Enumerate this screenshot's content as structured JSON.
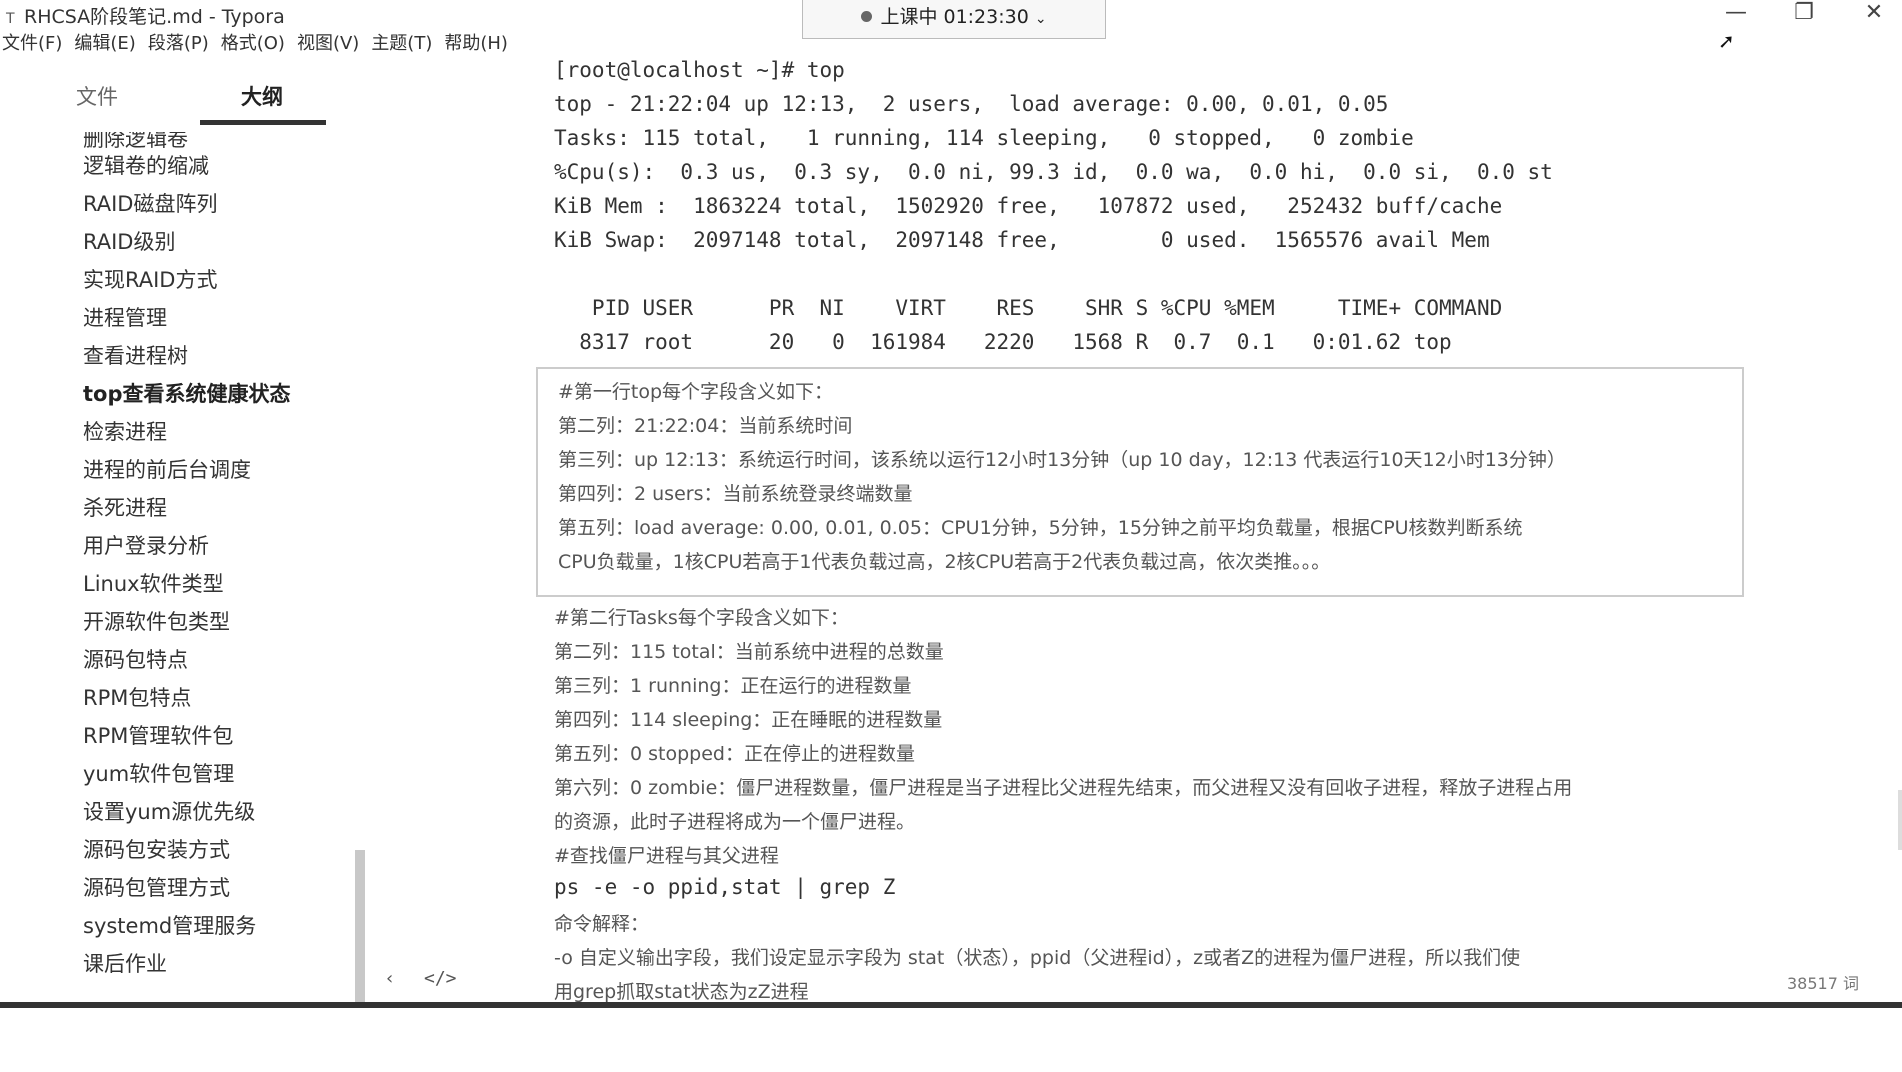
{
  "window": {
    "title": "RHCSA阶段笔记.md - Typora",
    "minimize_glyph": "—",
    "maximize_glyph": "❐",
    "close_glyph": "✕"
  },
  "menubar": [
    "文件(F)",
    "编辑(E)",
    "段落(P)",
    "格式(O)",
    "视图(V)",
    "主题(T)",
    "帮助(H)"
  ],
  "recording": {
    "label": "上课中 01:23:30",
    "chevron": "⌄"
  },
  "sidebar": {
    "tabs": [
      "文件",
      "大纲"
    ],
    "active_tab": 1,
    "items": [
      "删除逻辑卷",
      "逻辑卷的缩减",
      "RAID磁盘阵列",
      "RAID级别",
      "实现RAID方式",
      "进程管理",
      "查看进程树",
      "top查看系统健康状态",
      "检索进程",
      "进程的前后台调度",
      "杀死进程",
      "用户登录分析",
      "Linux软件类型",
      "开源软件包类型",
      "源码包特点",
      "RPM包特点",
      "RPM管理软件包",
      "yum软件包管理",
      "设置yum源优先级",
      "源码包安装方式",
      "源码包管理方式",
      "systemd管理服务",
      "课后作业"
    ],
    "active_item": 7,
    "footer_left": "‹",
    "footer_code": "</>"
  },
  "terminal": {
    "lines": [
      "[root@localhost ~]# top",
      "top - 21:22:04 up 12:13,  2 users,  load average: 0.00, 0.01, 0.05",
      "Tasks: 115 total,   1 running, 114 sleeping,   0 stopped,   0 zombie",
      "%Cpu(s):  0.3 us,  0.3 sy,  0.0 ni, 99.3 id,  0.0 wa,  0.0 hi,  0.0 si,  0.0 st",
      "KiB Mem :  1863224 total,  1502920 free,   107872 used,   252432 buff/cache",
      "KiB Swap:  2097148 total,  2097148 free,        0 used.  1565576 avail Mem",
      "",
      "   PID USER      PR  NI    VIRT    RES    SHR S %CPU %MEM     TIME+ COMMAND",
      "  8317 root      20   0  161984   2220   1568 R  0.7  0.1   0:01.62 top"
    ]
  },
  "box": {
    "lines": [
      "#第一行top每个字段含义如下：",
      "第二列：21:22:04：当前系统时间",
      "第三列：up 12:13：系统运行时间，该系统以运行12小时13分钟（up 10 day，12:13 代表运行10天12小时13分钟）",
      "第四列：2 users：当前系统登录终端数量",
      "第五列：load average: 0.00, 0.01, 0.05：CPU1分钟，5分钟，15分钟之前平均负载量，根据CPU核数判断系统",
      "CPU负载量，1核CPU若高于1代表负载过高，2核CPU若高于2代表负载过高，依次类推。。。"
    ]
  },
  "notes": {
    "lines": [
      "#第二行Tasks每个字段含义如下：",
      "第二列：115 total：当前系统中进程的总数量",
      "第三列：1 running：正在运行的进程数量",
      "第四列：114 sleeping：正在睡眠的进程数量",
      "第五列：0 stopped：正在停止的进程数量",
      "第六列：0 zombie：僵尸进程数量，僵尸进程是当子进程比父进程先结束，而父进程又没有回收子进程，释放子进程占用",
      "的资源，此时子进程将成为一个僵尸进程。",
      "#查找僵尸进程与其父进程",
      "ps -e -o ppid,stat | grep Z",
      "命令解释：",
      "-o 自定义输出字段，我们设定显示字段为 stat（状态），ppid（父进程id），z或者Z的进程为僵尸进程，所以我们使",
      "用grep抓取stat状态为zZ进程"
    ]
  },
  "status": {
    "word_count": "38517 词"
  }
}
